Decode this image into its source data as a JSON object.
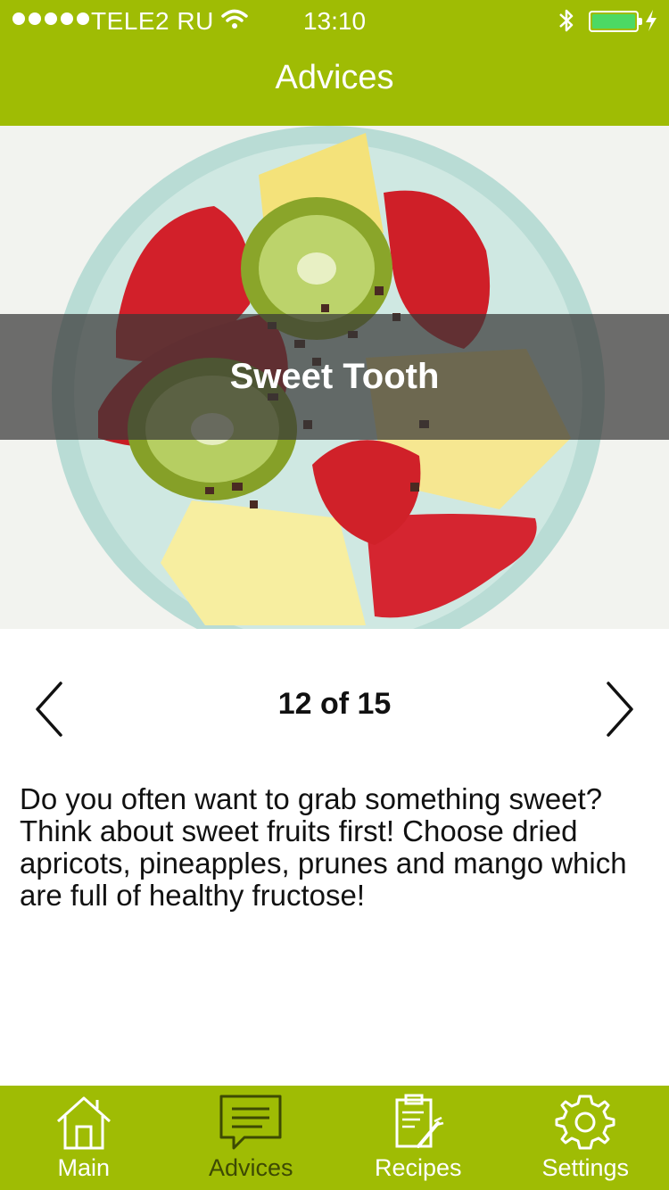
{
  "status_bar": {
    "carrier": "TELE2 RU",
    "time": "13:10",
    "battery_level": 1.0
  },
  "nav": {
    "title": "Advices"
  },
  "hero": {
    "title": "Sweet Tooth"
  },
  "pager": {
    "counter": "12 of 15"
  },
  "advice": {
    "text": "Do you often want to grab something sweet? Think about sweet fruits first! Choose dried apricots, pineapples, prunes and mango which are full of healthy fructose!"
  },
  "tabbar": {
    "tabs": [
      {
        "label": "Main",
        "icon": "home-icon",
        "active": false
      },
      {
        "label": "Advices",
        "icon": "chat-bubble-icon",
        "active": true
      },
      {
        "label": "Recipes",
        "icon": "recipe-clipboard-icon",
        "active": false
      },
      {
        "label": "Settings",
        "icon": "gear-icon",
        "active": false
      }
    ]
  },
  "colors": {
    "brand_green": "#9fbc04",
    "active_tab_text": "#3d4a03"
  }
}
